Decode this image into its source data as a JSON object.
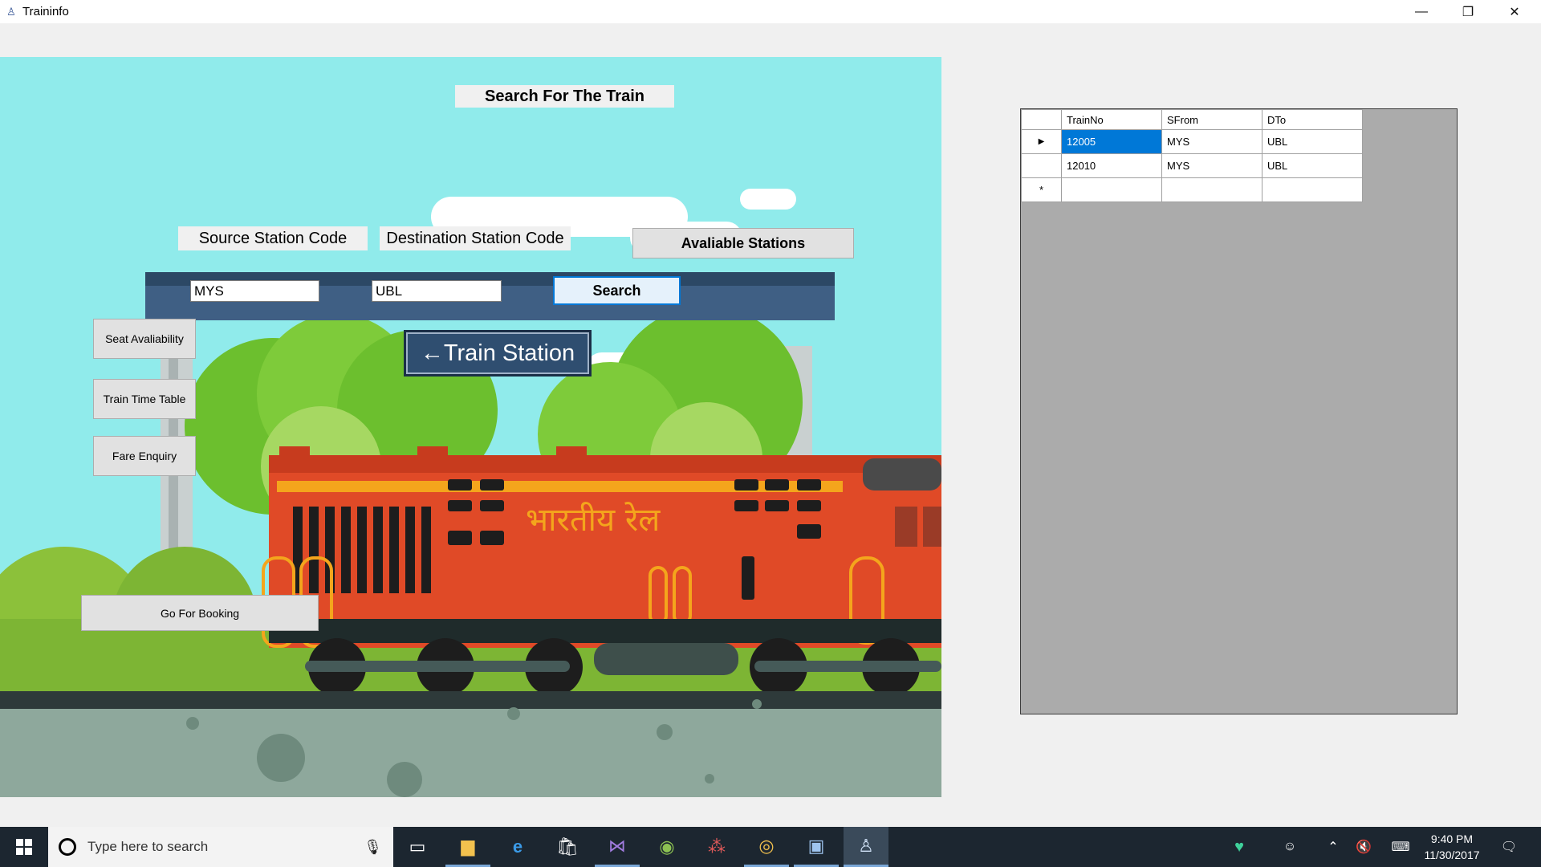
{
  "window": {
    "title": "Traininfo",
    "minimize": "—",
    "restore": "❐",
    "close": "✕"
  },
  "form": {
    "heading": "Search For The Train",
    "source_label": "Source Station Code",
    "destination_label": "Destination Station Code",
    "available_stations_button": "Avaliable Stations",
    "source_value": "MYS",
    "destination_value": "UBL",
    "search_button": "Search",
    "train_station_button": "←Train Station",
    "seat_availability_button": "Seat Avaliability",
    "train_time_table_button": "Train Time Table",
    "fare_enquiry_button": "Fare Enquiry",
    "go_for_booking_button": "Go For Booking",
    "rail_text": "भारतीय रेल"
  },
  "grid": {
    "columns": [
      "TrainNo",
      "SFrom",
      "DTo"
    ],
    "rows": [
      [
        "12005",
        "MYS",
        "UBL"
      ],
      [
        "12010",
        "MYS",
        "UBL"
      ]
    ],
    "current_row_marker": "▶",
    "new_row_marker": "*"
  },
  "taskbar": {
    "search_placeholder": "Type here to search",
    "time": "9:40 PM",
    "date": "11/30/2017"
  },
  "colors": {
    "sky": "#90ebeb",
    "selection": "#0078d7",
    "train_red": "#e04a27",
    "stripe": "#f4a51c",
    "taskbar": "#1c2630"
  }
}
